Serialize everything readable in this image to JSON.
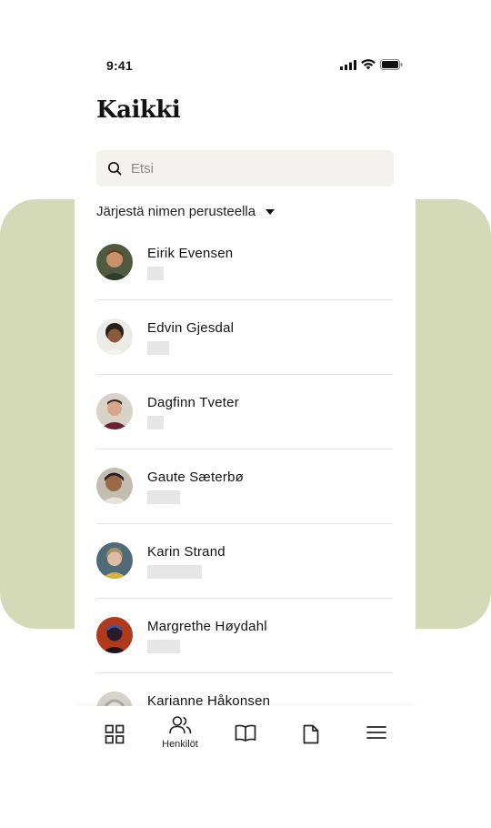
{
  "status_bar": {
    "time": "9:41"
  },
  "page": {
    "title": "Kaikki"
  },
  "search": {
    "placeholder": "Etsi"
  },
  "sort": {
    "label": "Järjestä nimen perusteella"
  },
  "people": [
    {
      "name": "Eirik Evensen",
      "avatar_color": "#5a4a3a"
    },
    {
      "name": "Edvin Gjesdal",
      "avatar_color": "#e8e4df"
    },
    {
      "name": "Dagfinn Tveter",
      "avatar_color": "#6b2a2e"
    },
    {
      "name": "Gaute Sæterbø",
      "avatar_color": "#b5a99a"
    },
    {
      "name": "Karin Strand",
      "avatar_color": "#4f6b78"
    },
    {
      "name": "Margrethe Høydahl",
      "avatar_color": "#b23a1c"
    },
    {
      "name": "Karianne Håkonsen",
      "avatar_color": "#c7c2ba"
    }
  ],
  "tabbar": {
    "tabs": [
      {
        "icon": "grid-icon",
        "label": ""
      },
      {
        "icon": "people-icon",
        "label": "Henkilöt"
      },
      {
        "icon": "book-icon",
        "label": ""
      },
      {
        "icon": "document-icon",
        "label": ""
      },
      {
        "icon": "menu-icon",
        "label": ""
      }
    ]
  },
  "colors": {
    "background_panel": "#d4dab7",
    "search_bg": "#f3f2ef",
    "placeholder_tag": "#e6e6e6"
  }
}
